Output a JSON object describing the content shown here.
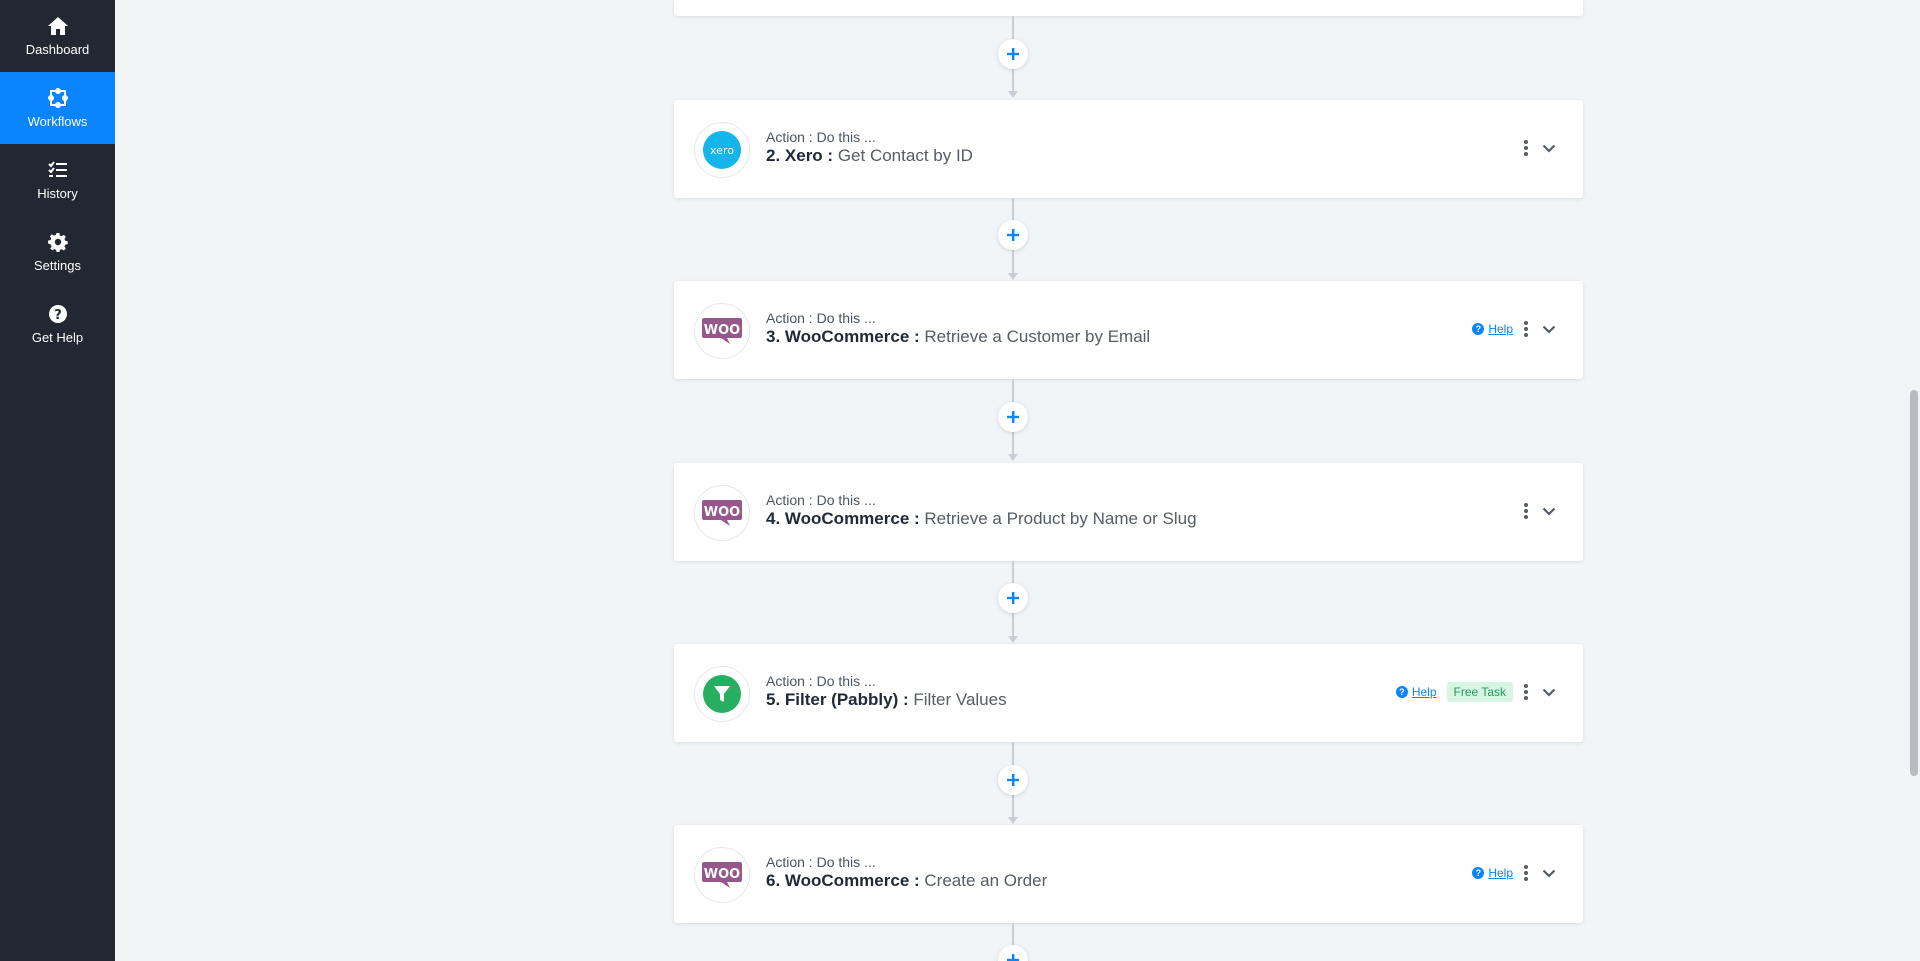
{
  "sidebar": {
    "items": [
      {
        "label": "Dashboard",
        "icon": "home-icon",
        "active": false
      },
      {
        "label": "Workflows",
        "icon": "workflow-icon",
        "active": true
      },
      {
        "label": "History",
        "icon": "history-list-icon",
        "active": false
      },
      {
        "label": "Settings",
        "icon": "gear-icon",
        "active": false
      },
      {
        "label": "Get Help",
        "icon": "question-circle-icon",
        "active": false
      }
    ]
  },
  "steps": [
    {
      "kicker": "Action : Do this ...",
      "app": "2. Xero :",
      "event": "Get Contact by ID",
      "logo": "xero-logo",
      "logo_text": "xero",
      "help": false,
      "free_task": false
    },
    {
      "kicker": "Action : Do this ...",
      "app": "3. WooCommerce :",
      "event": "Retrieve a Customer by Email",
      "logo": "woocommerce-logo",
      "logo_text": "WOO",
      "help": true,
      "help_label": "Help",
      "free_task": false
    },
    {
      "kicker": "Action : Do this ...",
      "app": "4. WooCommerce :",
      "event": "Retrieve a Product by Name or Slug",
      "logo": "woocommerce-logo",
      "logo_text": "WOO",
      "help": false,
      "free_task": false
    },
    {
      "kicker": "Action : Do this ...",
      "app": "5. Filter (Pabbly) :",
      "event": "Filter Values",
      "logo": "filter-logo",
      "help": true,
      "help_label": "Help",
      "free_task": true,
      "free_task_label": "Free Task"
    },
    {
      "kicker": "Action : Do this ...",
      "app": "6. WooCommerce :",
      "event": "Create an Order",
      "logo": "woocommerce-logo",
      "logo_text": "WOO",
      "help": true,
      "help_label": "Help",
      "free_task": false
    }
  ],
  "colors": {
    "sidebar_bg": "#222831",
    "active_nav": "#0b84ff",
    "link": "#0b84ff",
    "xero": "#13b5ea",
    "woocommerce": "#96588a",
    "filter": "#27ae60",
    "free_task_bg": "#d6f5e3",
    "free_task_text": "#1e9e5a"
  }
}
